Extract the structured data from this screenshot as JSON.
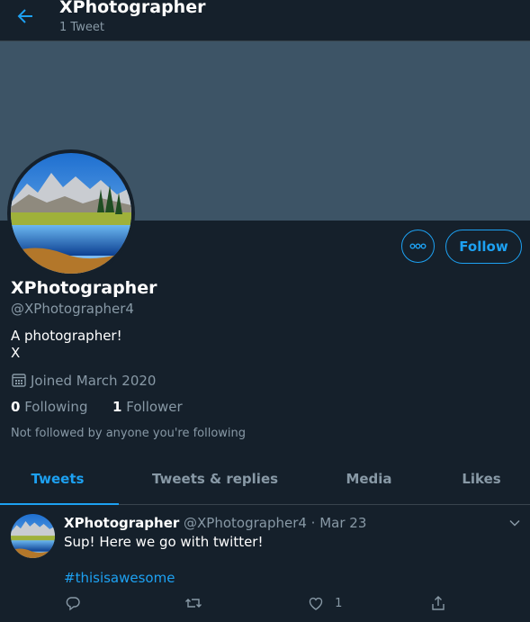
{
  "header": {
    "title": "XPhotographer",
    "subtitle": "1 Tweet"
  },
  "profile": {
    "name": "XPhotographer",
    "handle": "@XPhotographer4",
    "bio_line1": "A photographer!",
    "bio_line2": "X",
    "joined": "Joined March 2020",
    "following_count": "0",
    "following_label": "Following",
    "followers_count": "1",
    "followers_label": "Follower",
    "follow_context": "Not followed by anyone you're following",
    "follow_button": "Follow"
  },
  "tabs": [
    {
      "label": "Tweets",
      "active": true
    },
    {
      "label": "Tweets & replies",
      "active": false
    },
    {
      "label": "Media",
      "active": false
    },
    {
      "label": "Likes",
      "active": false
    }
  ],
  "tweet": {
    "author": "XPhotographer",
    "meta": "@XPhotographer4 · Mar 23",
    "text": "Sup! Here we go with twitter!",
    "hashtag": "#thisisawesome",
    "like_count": "1"
  },
  "colors": {
    "background": "#15202b",
    "accent": "#1da1f2",
    "banner": "#3d5466",
    "muted": "#8899a6"
  },
  "icons": [
    "back-arrow-icon",
    "more-icon",
    "calendar-icon",
    "chevron-down-icon",
    "reply-icon",
    "retweet-icon",
    "like-icon",
    "share-icon"
  ]
}
